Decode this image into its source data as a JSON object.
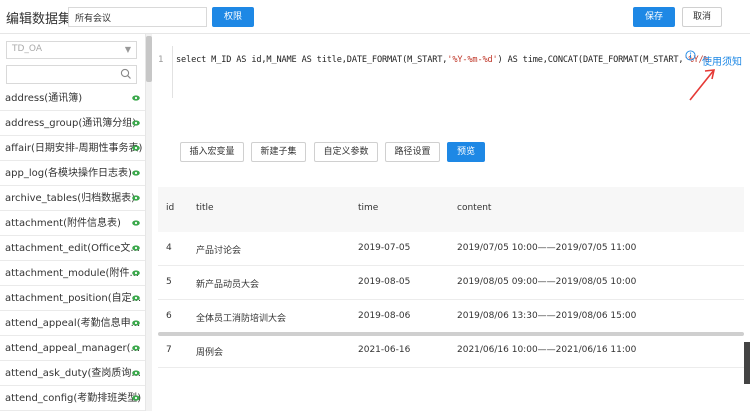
{
  "header": {
    "title": "编辑数据集",
    "name_value": "所有会议",
    "permission_label": "权限",
    "save_label": "保存",
    "cancel_label": "取消"
  },
  "sidebar": {
    "database": "TD_OA",
    "search_placeholder": "",
    "tables": [
      {
        "label": "address(通讯簿)"
      },
      {
        "label": "address_group(通讯簿分组)"
      },
      {
        "label": "affair(日期安排-周期性事务表)"
      },
      {
        "label": "app_log(各模块操作日志表)"
      },
      {
        "label": "archive_tables(归档数据表)"
      },
      {
        "label": "attachment(附件信息表)"
      },
      {
        "label": "attachment_edit(Office文..."
      },
      {
        "label": "attachment_module(附件..."
      },
      {
        "label": "attachment_position(自定..."
      },
      {
        "label": "attend_appeal(考勤信息申..."
      },
      {
        "label": "attend_appeal_manager(..."
      },
      {
        "label": "attend_ask_duty(查岗质询..."
      },
      {
        "label": "attend_config(考勤排班类型)"
      }
    ]
  },
  "editor": {
    "line_number": "1",
    "code_part1": "select M_ID AS id,M_NAME AS title,DATE_FORMAT(M_START,",
    "code_str1": "'%Y-%m-%d'",
    "code_part2": ") AS time,CONCAT(DATE_FORMAT(M_START,",
    "code_str2": "'%Y/%"
  },
  "help": {
    "label": "使用须知"
  },
  "toolbar": {
    "insert_var": "插入宏变量",
    "new_subset": "新建子集",
    "custom_params": "自定义参数",
    "path_settings": "路径设置",
    "preview": "预览"
  },
  "results": {
    "columns": [
      "id",
      "title",
      "time",
      "content"
    ],
    "rows": [
      [
        "4",
        "产品讨论会",
        "2019-07-05",
        "2019/07/05 10:00——2019/07/05 11:00"
      ],
      [
        "5",
        "新产品动员大会",
        "2019-08-05",
        "2019/08/05 09:00——2019/08/05 10:00"
      ],
      [
        "6",
        "全体员工消防培训大会",
        "2019-08-06",
        "2019/08/06 13:30——2019/08/06 15:00"
      ],
      [
        "7",
        "周例会",
        "2021-06-16",
        "2021/06/16 10:00——2021/06/16 11:00"
      ]
    ]
  },
  "colors": {
    "accent": "#1e88e5",
    "eye": "#3aa84b",
    "annotation": "#e53935"
  }
}
